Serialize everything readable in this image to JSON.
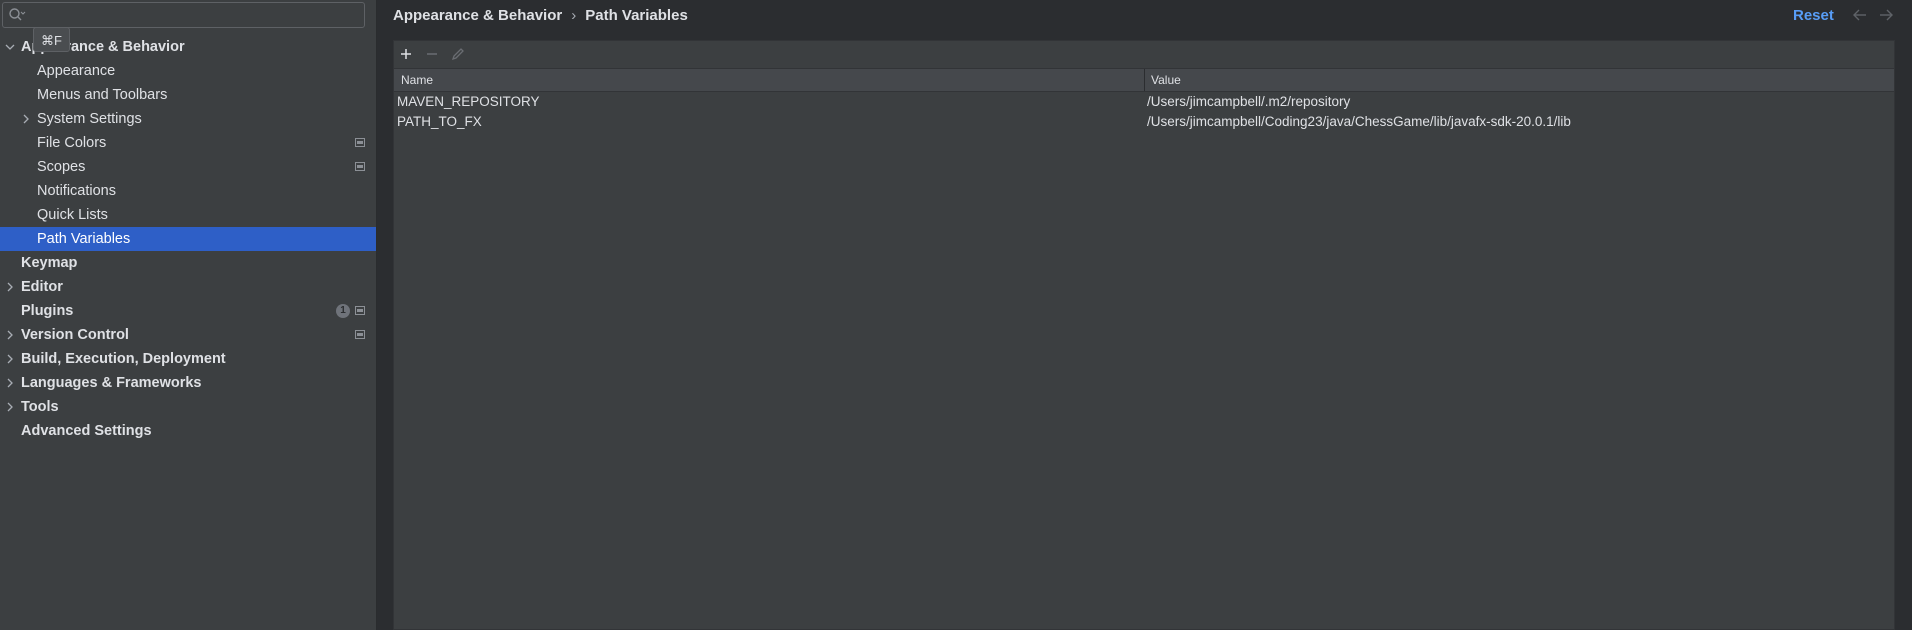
{
  "search": {
    "value": "",
    "placeholder": ""
  },
  "tooltip": "⌘F",
  "sidebar": {
    "items": [
      {
        "label": "Appearance & Behavior",
        "bold": true,
        "expanded": true,
        "chevron": "chevron-down-icon"
      },
      {
        "label": "Appearance"
      },
      {
        "label": "Menus and Toolbars"
      },
      {
        "label": "System Settings",
        "chevron": "chevron-right-icon"
      },
      {
        "label": "File Colors",
        "project_icon": true
      },
      {
        "label": "Scopes",
        "project_icon": true
      },
      {
        "label": "Notifications"
      },
      {
        "label": "Quick Lists"
      },
      {
        "label": "Path Variables",
        "selected": true
      },
      {
        "label": "Keymap",
        "bold": true
      },
      {
        "label": "Editor",
        "bold": true,
        "chevron": "chevron-right-icon"
      },
      {
        "label": "Plugins",
        "bold": true,
        "badge": "1",
        "project_icon": true
      },
      {
        "label": "Version Control",
        "bold": true,
        "chevron": "chevron-right-icon",
        "project_icon": true
      },
      {
        "label": "Build, Execution, Deployment",
        "bold": true,
        "chevron": "chevron-right-icon"
      },
      {
        "label": "Languages & Frameworks",
        "bold": true,
        "chevron": "chevron-right-icon"
      },
      {
        "label": "Tools",
        "bold": true,
        "chevron": "chevron-right-icon"
      },
      {
        "label": "Advanced Settings",
        "bold": true
      }
    ]
  },
  "breadcrumb": {
    "parent": "Appearance & Behavior",
    "separator": "›",
    "current": "Path Variables"
  },
  "header": {
    "reset_label": "Reset"
  },
  "table": {
    "columns": [
      "Name",
      "Value"
    ],
    "rows": [
      {
        "name": "MAVEN_REPOSITORY",
        "value": "/Users/jimcampbell/.m2/repository"
      },
      {
        "name": "PATH_TO_FX",
        "value": "/Users/jimcampbell/Coding23/java/ChessGame/lib/javafx-sdk-20.0.1/lib"
      }
    ]
  },
  "colors": {
    "accent": "#589df6",
    "selection": "#2e5fc7",
    "background": "#2b2d30",
    "panel": "#3c3f41"
  }
}
